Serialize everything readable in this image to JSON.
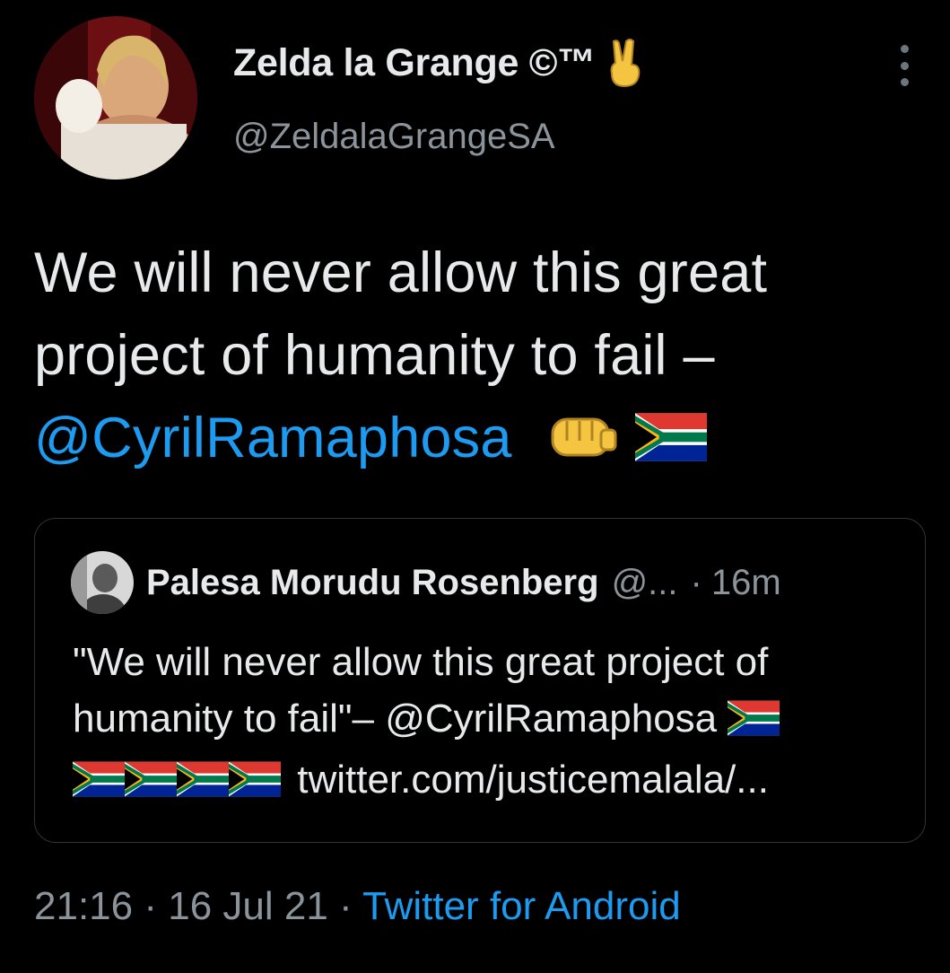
{
  "author": {
    "name": "Zelda la Grange ©™",
    "handle": "@ZeldalaGrangeSA",
    "name_emoji": "victory-hand-emoji",
    "avatar": "profile-photo-woman-smiling"
  },
  "more_menu_icon": "vertical-ellipsis-icon",
  "tweet": {
    "text": "We will never allow this great project of humanity to fail –",
    "mention": "@CyrilRamaphosa",
    "emojis": [
      "oncoming-fist-emoji",
      "south-africa-flag-emoji"
    ]
  },
  "quoted_tweet": {
    "name": "Palesa Morudu Rosenberg",
    "handle": "@...",
    "separator": "·",
    "time": "16m",
    "text_line1": "\"We will never allow this great project of",
    "text_line2": "humanity to fail\"– @CyrilRamaphosa",
    "link": "twitter.com/justicemalala/...",
    "flag_count": 5
  },
  "meta": {
    "time": "21:16",
    "separator": "·",
    "date": "16 Jul 21",
    "source": "Twitter for Android"
  },
  "colors": {
    "background": "#000000",
    "text": "#e7e9ea",
    "secondary": "#8b949b",
    "accent": "#1d9bf0",
    "border": "#2f3336"
  }
}
